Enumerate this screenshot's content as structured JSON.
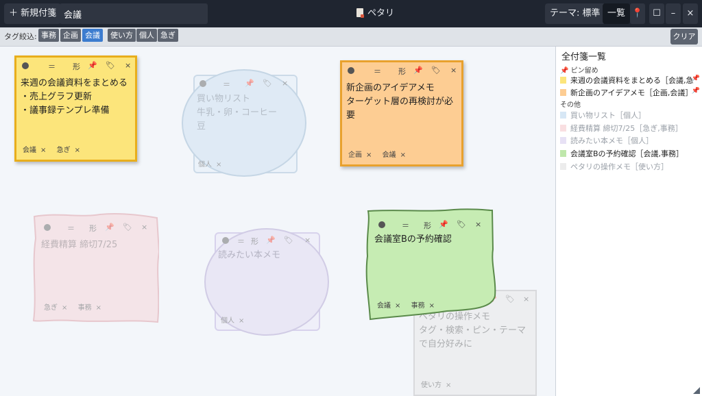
{
  "topbar": {
    "new_note": "＋ 新規付箋",
    "search_value": "会議",
    "app_title": "ペタリ",
    "theme": "テーマ: 標準",
    "list": "一覧",
    "pin_glyph": "📍",
    "maximize": "☐",
    "minimize": "–",
    "close": "×"
  },
  "tagbar": {
    "label": "タグ絞込:",
    "tags": [
      "事務",
      "企画",
      "会議",
      "使い方",
      "個人",
      "急ぎ"
    ],
    "active": "会議",
    "clear": "クリア"
  },
  "note_controls": {
    "drag": "＝",
    "shape": "形",
    "pin": "📌",
    "tag": "🏷",
    "close": "×"
  },
  "notes": [
    {
      "text": "来週の会議資料をまとめる\n・売上グラフ更新\n・議事録テンプレ準備",
      "tags": [
        "会議",
        "急ぎ"
      ],
      "color": "#fce57b"
    },
    {
      "text": "買い物リスト\n牛乳・卵・コーヒー\n豆",
      "tags": [
        "個人"
      ],
      "color": "#c8ddf0"
    },
    {
      "text": "新企画のアイデアメモ\nターゲット層の再検討が必\n要",
      "tags": [
        "企画",
        "会議"
      ],
      "color": "#fdcd93"
    },
    {
      "text": "経費精算 締切7/25",
      "tags": [
        "急ぎ",
        "事務"
      ],
      "color": "#f6d0d3"
    },
    {
      "text": "読みたい本メモ",
      "tags": [
        "個人"
      ],
      "color": "#ddd5f0"
    },
    {
      "text": "会議室Bの予約確認",
      "tags": [
        "会議",
        "事務"
      ],
      "color": "#c6ecb3"
    },
    {
      "text": "ペタリの操作メモ\nタグ・検索・ピン・テーマ\nで自分好みに",
      "tags": [
        "使い方"
      ],
      "color": "#e6e6e6"
    }
  ],
  "sidebar": {
    "title": "全付箋一覧",
    "pinned_label": "ピン留め",
    "other_label": "その他",
    "pinned": [
      {
        "text": "来週の会議資料をまとめる［会議,急",
        "color": "#fce57b"
      },
      {
        "text": "新企画のアイデアメモ［企画,会議］",
        "color": "#fdcd93"
      }
    ],
    "others": [
      {
        "text": "買い物リスト［個人］",
        "color": "#d7e7f5",
        "dim": true
      },
      {
        "text": "経費精算 締切7/25［急ぎ,事務］",
        "color": "#f9dfe1",
        "dim": true
      },
      {
        "text": "読みたい本メモ［個人］",
        "color": "#e7e1f5",
        "dim": true
      },
      {
        "text": "会議室Bの予約確認［会議,事務］",
        "color": "#bfe7ab",
        "dim": false
      },
      {
        "text": "ペタリの操作メモ［使い方］",
        "color": "#ececec",
        "dim": true
      }
    ]
  }
}
